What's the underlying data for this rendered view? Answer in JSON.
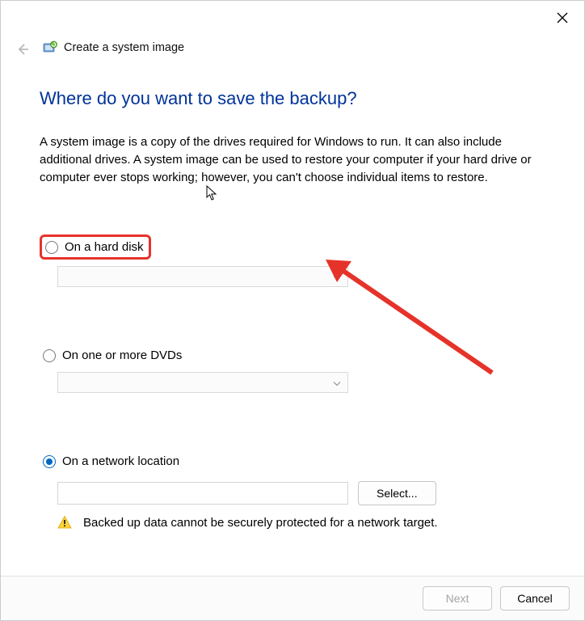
{
  "window": {
    "title": "Create a system image"
  },
  "heading": "Where do you want to save the backup?",
  "description": "A system image is a copy of the drives required for Windows to run. It can also include additional drives. A system image can be used to restore your computer if your hard drive or computer ever stops working; however, you can't choose individual items to restore.",
  "options": {
    "hard_disk": {
      "label": "On a hard disk",
      "selected": false
    },
    "dvds": {
      "label": "On one or more DVDs",
      "selected": false
    },
    "network": {
      "label": "On a network location",
      "selected": true,
      "select_button": "Select...",
      "warning": "Backed up data cannot be securely protected for a network target."
    }
  },
  "footer": {
    "next": "Next",
    "cancel": "Cancel"
  }
}
